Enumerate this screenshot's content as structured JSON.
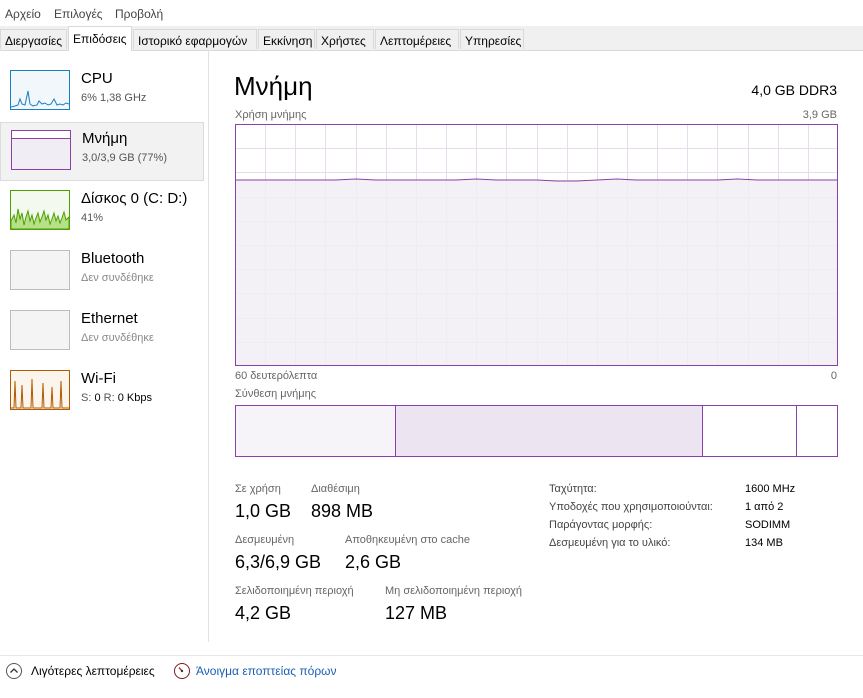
{
  "menu": [
    "Αρχείο",
    "Επιλογές",
    "Προβολή"
  ],
  "tabs": [
    "Διεργασίες",
    "Επιδόσεις",
    "Ιστορικό εφαρμογών",
    "Εκκίνηση",
    "Χρήστες",
    "Λεπτομέρειες",
    "Υπηρεσίες"
  ],
  "active_tab": "Επιδόσεις",
  "sidebar": [
    {
      "name": "CPU",
      "sub": "6% 1,38 GHz",
      "icon": "cpu-graph-icon",
      "color": "#1a7fbf"
    },
    {
      "name": "Μνήμη",
      "sub": "3,0/3,9 GB (77%)",
      "icon": "memory-graph-icon",
      "color": "#8b3fa8"
    },
    {
      "name": "Δίσκος 0 (C: D:)",
      "sub": "41%",
      "icon": "disk-graph-icon",
      "color": "#4da000"
    },
    {
      "name": "Bluetooth",
      "sub": "Δεν συνδέθηκε",
      "icon": "bluetooth-graph-icon",
      "color": "#bdbdbd"
    },
    {
      "name": "Ethernet",
      "sub": "Δεν συνδέθηκε",
      "icon": "ethernet-graph-icon",
      "color": "#bdbdbd"
    },
    {
      "name": "Wi-Fi",
      "sub_s": "S:",
      "sub_s_val": "0",
      "sub_r": "R:",
      "sub_r_val": "0 Kbps",
      "icon": "wifi-graph-icon",
      "color": "#b25a00"
    }
  ],
  "main": {
    "title": "Μνήμη",
    "spec": "4,0 GB DDR3",
    "usage_label": "Χρήση μνήμης",
    "usage_max": "3,9 GB",
    "time_label": "60 δευτερόλεπτα",
    "time_zero": "0",
    "usage_fraction": 0.77,
    "composition_label": "Σύνθεση μνήμης",
    "stats": {
      "in_use_label": "Σε χρήση",
      "in_use": "1,0 GB",
      "available_label": "Διαθέσιμη",
      "available": "898 MB",
      "committed_label": "Δεσμευμένη",
      "committed": "6,3/6,9 GB",
      "cached_label": "Αποθηκευμένη στο cache",
      "cached": "2,6 GB",
      "paged_label": "Σελιδοποιημένη περιοχή",
      "paged": "4,2 GB",
      "nonpaged_label": "Μη σελιδοποιημένη περιοχή",
      "nonpaged": "127 MB"
    },
    "info": [
      {
        "label": "Ταχύτητα:",
        "value": "1600 MHz"
      },
      {
        "label": "Υποδοχές που χρησιμοποιούνται:",
        "value": "1 από 2"
      },
      {
        "label": "Παράγοντας μορφής:",
        "value": "SODIMM"
      },
      {
        "label": "Δεσμευμένη για το υλικό:",
        "value": "134 MB"
      }
    ]
  },
  "footer": {
    "fewer_details": "Λιγότερες λεπτομέρειες",
    "open_resmon": "Άνοιγμα εποπτείας πόρων"
  },
  "colors": {
    "memory": "#8b3fa8",
    "memory_fill": "#f1edf4",
    "link": "#1a5fb4"
  }
}
